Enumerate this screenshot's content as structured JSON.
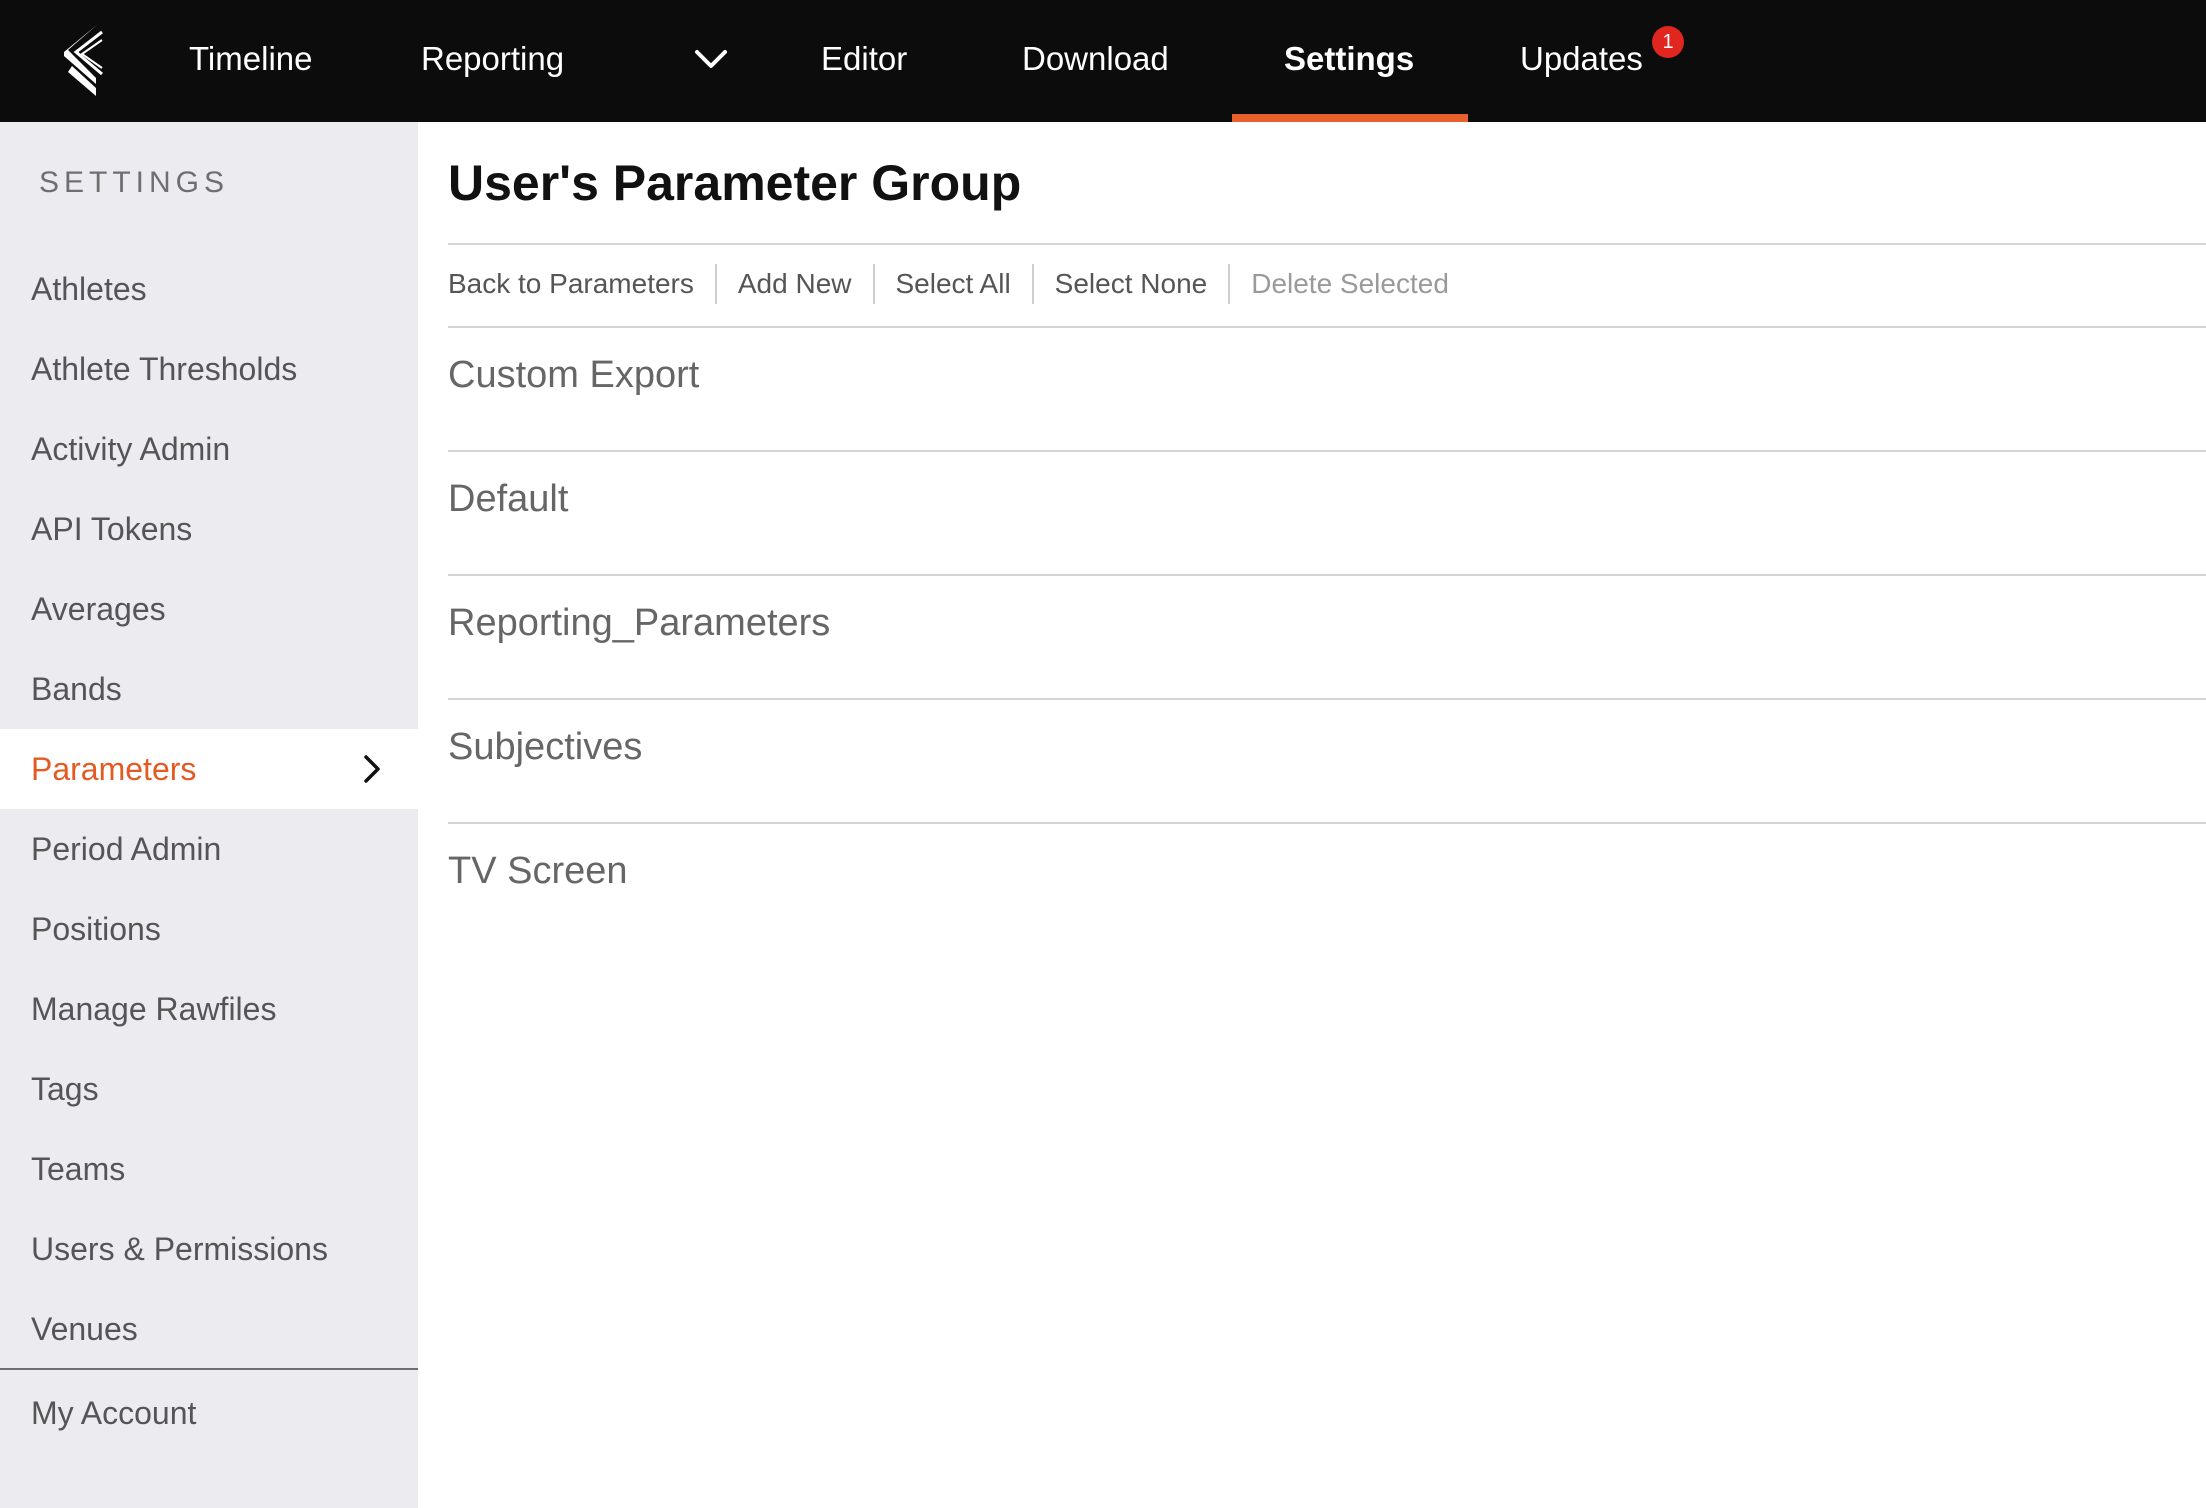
{
  "nav": {
    "items": [
      {
        "label": "Timeline"
      },
      {
        "label": "Reporting"
      },
      {
        "label": "Editor"
      },
      {
        "label": "Download"
      },
      {
        "label": "Settings"
      },
      {
        "label": "Updates"
      }
    ],
    "active": "Settings",
    "updates_badge": "1"
  },
  "sidebar": {
    "heading": "SETTINGS",
    "items": [
      {
        "label": "Athletes"
      },
      {
        "label": "Athlete Thresholds"
      },
      {
        "label": "Activity Admin"
      },
      {
        "label": "API Tokens"
      },
      {
        "label": "Averages"
      },
      {
        "label": "Bands"
      },
      {
        "label": "Parameters"
      },
      {
        "label": "Period Admin"
      },
      {
        "label": "Positions"
      },
      {
        "label": "Manage Rawfiles"
      },
      {
        "label": "Tags"
      },
      {
        "label": "Teams"
      },
      {
        "label": "Users & Permissions"
      },
      {
        "label": "Venues"
      }
    ],
    "active": "Parameters",
    "footer_item": "My Account"
  },
  "main": {
    "title": "User's Parameter Group",
    "toolbar": {
      "back": "Back to Parameters",
      "add_new": "Add New",
      "select_all": "Select All",
      "select_none": "Select None",
      "delete_selected": "Delete Selected"
    },
    "groups": [
      {
        "name": "Custom Export"
      },
      {
        "name": "Default"
      },
      {
        "name": "Reporting_Parameters"
      },
      {
        "name": "Subjectives"
      },
      {
        "name": "TV Screen"
      }
    ]
  },
  "colors": {
    "nav_bg": "#0c0c0c",
    "accent": "#e35b24",
    "badge": "#e0261f",
    "sidebar_bg": "#ececf0"
  }
}
